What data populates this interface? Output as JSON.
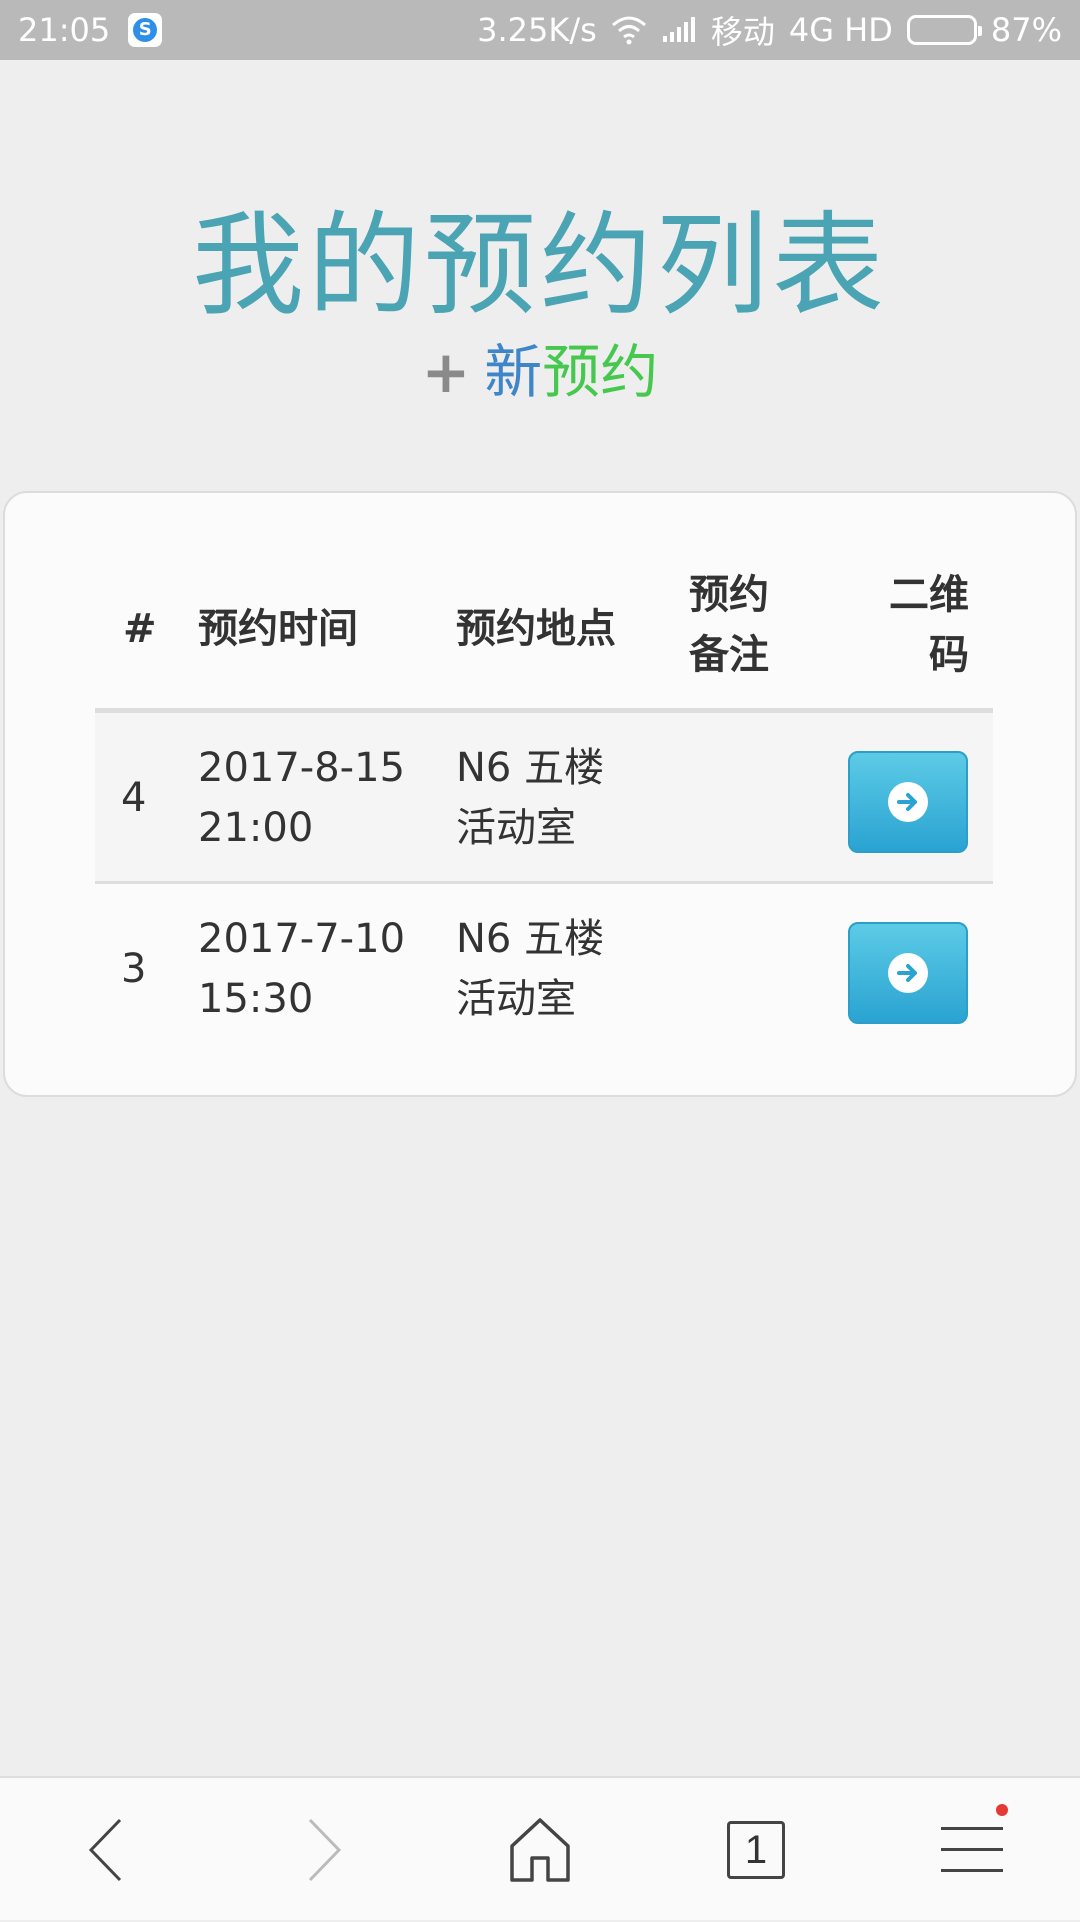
{
  "status_bar": {
    "time": "21:05",
    "net_speed": "3.25K/s",
    "carrier": "移动",
    "network": "4G HD",
    "battery_percent_label": "87%",
    "battery_level": 0.87
  },
  "header": {
    "title": "我的预约列表",
    "new_plus": "+",
    "new_word": "新",
    "booking_word": "预约"
  },
  "table": {
    "headers": {
      "num": "#",
      "time": "预约时间",
      "place": "预约地点",
      "note_line1": "预约",
      "note_line2": "备注",
      "qr_line1": "二维",
      "qr_line2": "码"
    },
    "rows": [
      {
        "num": "4",
        "date": "2017-8-15",
        "clock": "21:00",
        "place_line1": "N6 五楼",
        "place_line2": "活动室",
        "note": ""
      },
      {
        "num": "3",
        "date": "2017-7-10",
        "clock": "15:30",
        "place_line1": "N6 五楼",
        "place_line2": "活动室",
        "note": ""
      }
    ]
  },
  "bottom_nav": {
    "tab_count": "1",
    "icons": [
      "back-icon",
      "forward-icon",
      "home-icon",
      "tabs-icon",
      "menu-icon"
    ]
  },
  "colors": {
    "title": "#4ba4b4",
    "new_word": "#3f86c9",
    "booking_word": "#46c84e",
    "qr_button": "#2aa3d2",
    "menu_badge": "#e53935"
  }
}
